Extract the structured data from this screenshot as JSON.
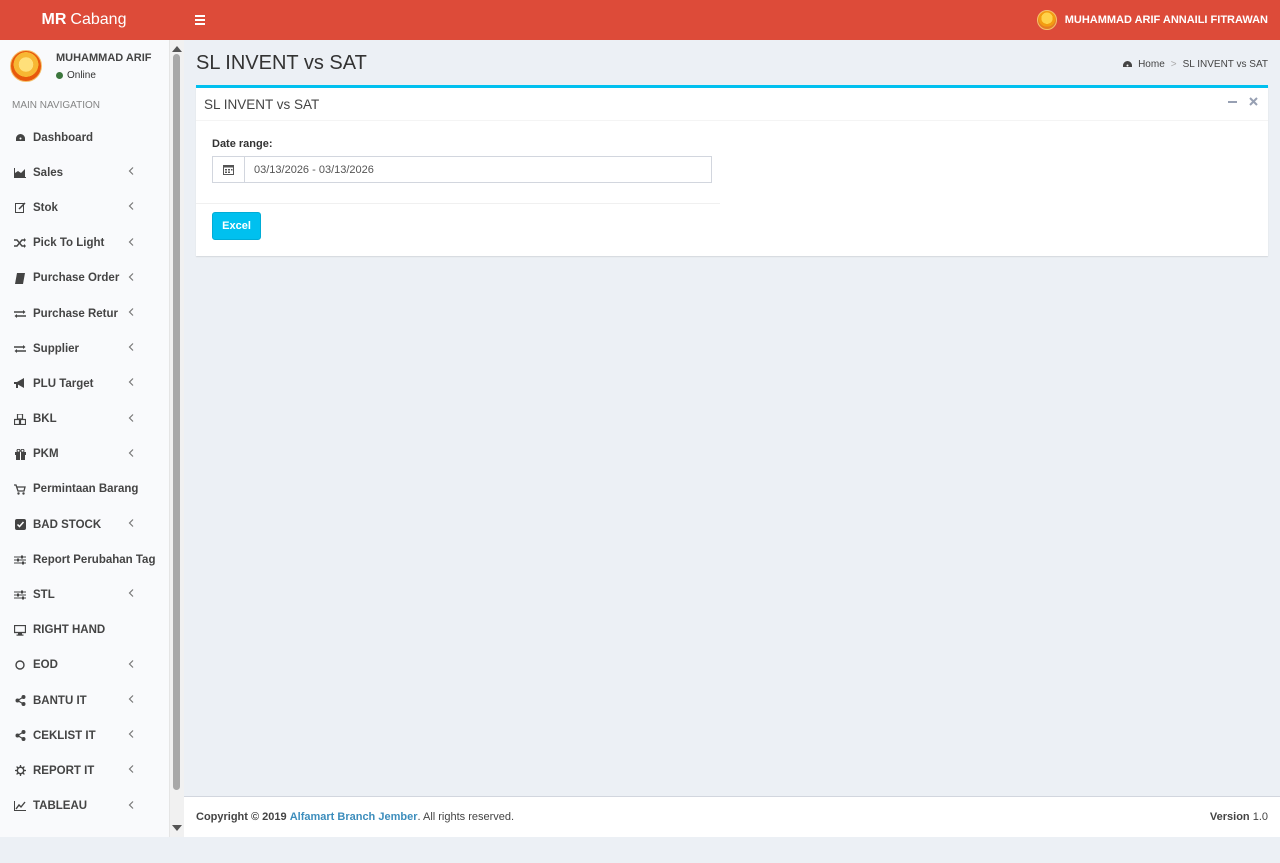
{
  "header": {
    "logo_bold": "MR",
    "logo_rest": "Cabang",
    "user_name": "MUHAMMAD ARIF ANNAILI FITRAWAN",
    "toggle_icon": "hamburger-icon"
  },
  "sidebar": {
    "user_name": "MUHAMMAD ARIF",
    "status": "Online",
    "nav_header": "MAIN NAVIGATION",
    "items": [
      {
        "label": "Dashboard",
        "icon": "dashboard-icon",
        "expandable": false
      },
      {
        "label": "Sales",
        "icon": "area-chart-icon",
        "expandable": true
      },
      {
        "label": "Stok",
        "icon": "edit-icon",
        "expandable": true
      },
      {
        "label": "Pick To Light",
        "icon": "random-icon",
        "expandable": true
      },
      {
        "label": "Purchase Order",
        "icon": "book-icon",
        "expandable": true
      },
      {
        "label": "Purchase Retur",
        "icon": "exchange-icon",
        "expandable": true
      },
      {
        "label": "Supplier",
        "icon": "exchange-icon",
        "expandable": true
      },
      {
        "label": "PLU Target",
        "icon": "bullhorn-icon",
        "expandable": true
      },
      {
        "label": "BKL",
        "icon": "cubes-icon",
        "expandable": true
      },
      {
        "label": "PKM",
        "icon": "gift-icon",
        "expandable": true
      },
      {
        "label": "Permintaan Barang",
        "icon": "cart-icon",
        "expandable": false
      },
      {
        "label": "BAD STOCK",
        "icon": "check-square-icon",
        "expandable": true
      },
      {
        "label": "Report Perubahan Tag",
        "icon": "sliders-icon",
        "expandable": false
      },
      {
        "label": "STL",
        "icon": "sliders-icon",
        "expandable": true
      },
      {
        "label": "RIGHT HAND",
        "icon": "desktop-icon",
        "expandable": false
      },
      {
        "label": "EOD",
        "icon": "circle-icon",
        "expandable": true
      },
      {
        "label": "BANTU IT",
        "icon": "share-icon",
        "expandable": true
      },
      {
        "label": "CEKLIST IT",
        "icon": "share-icon",
        "expandable": true
      },
      {
        "label": "REPORT IT",
        "icon": "gear-icon",
        "expandable": true
      },
      {
        "label": "TABLEAU",
        "icon": "line-chart-icon",
        "expandable": true
      }
    ]
  },
  "content": {
    "title": "SL INVENT vs SAT",
    "breadcrumb_home": "Home",
    "breadcrumb_current": "SL INVENT vs SAT",
    "box_title": "SL INVENT vs SAT",
    "date_label": "Date range:",
    "date_value": "03/13/2026 - 03/13/2026",
    "excel_label": "Excel"
  },
  "footer": {
    "copyright": "Copyright © 2019",
    "brand": "Alfamart Branch Jember",
    "rights": ". All rights reserved.",
    "version_label": "Version",
    "version_value": "1.0"
  },
  "colors": {
    "header": "#dd4b39",
    "accent": "#00c0ef",
    "link": "#3c8dbc",
    "background": "#ecf0f5"
  }
}
